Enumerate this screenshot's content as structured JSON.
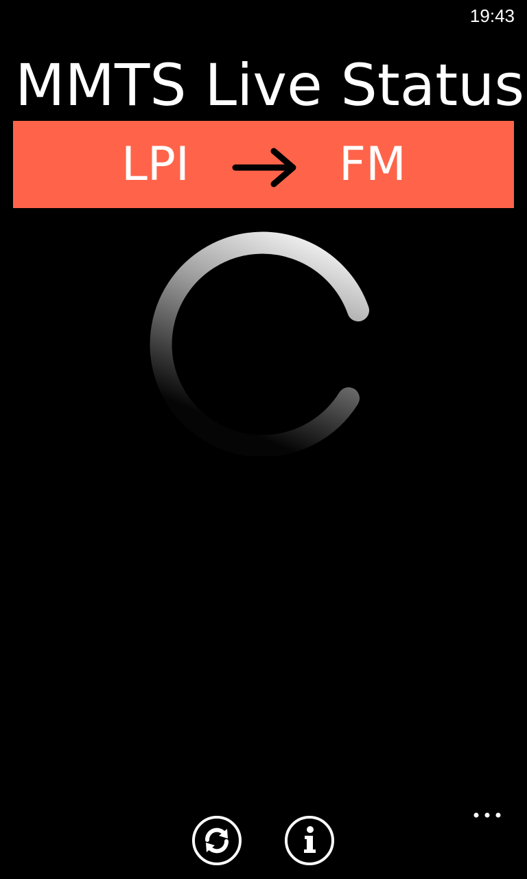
{
  "status_bar": {
    "time": "19:43"
  },
  "header": {
    "title": "MMTS Live Status"
  },
  "route": {
    "from": "LPI",
    "to": "FM",
    "arrow_icon": "arrow-right-icon",
    "background_color": "#ff644a"
  },
  "loading": {
    "indicator": "progress-ring"
  },
  "app_bar": {
    "buttons": [
      {
        "icon": "refresh-icon"
      },
      {
        "icon": "info-icon"
      }
    ],
    "more_icon": "ellipsis-icon"
  }
}
